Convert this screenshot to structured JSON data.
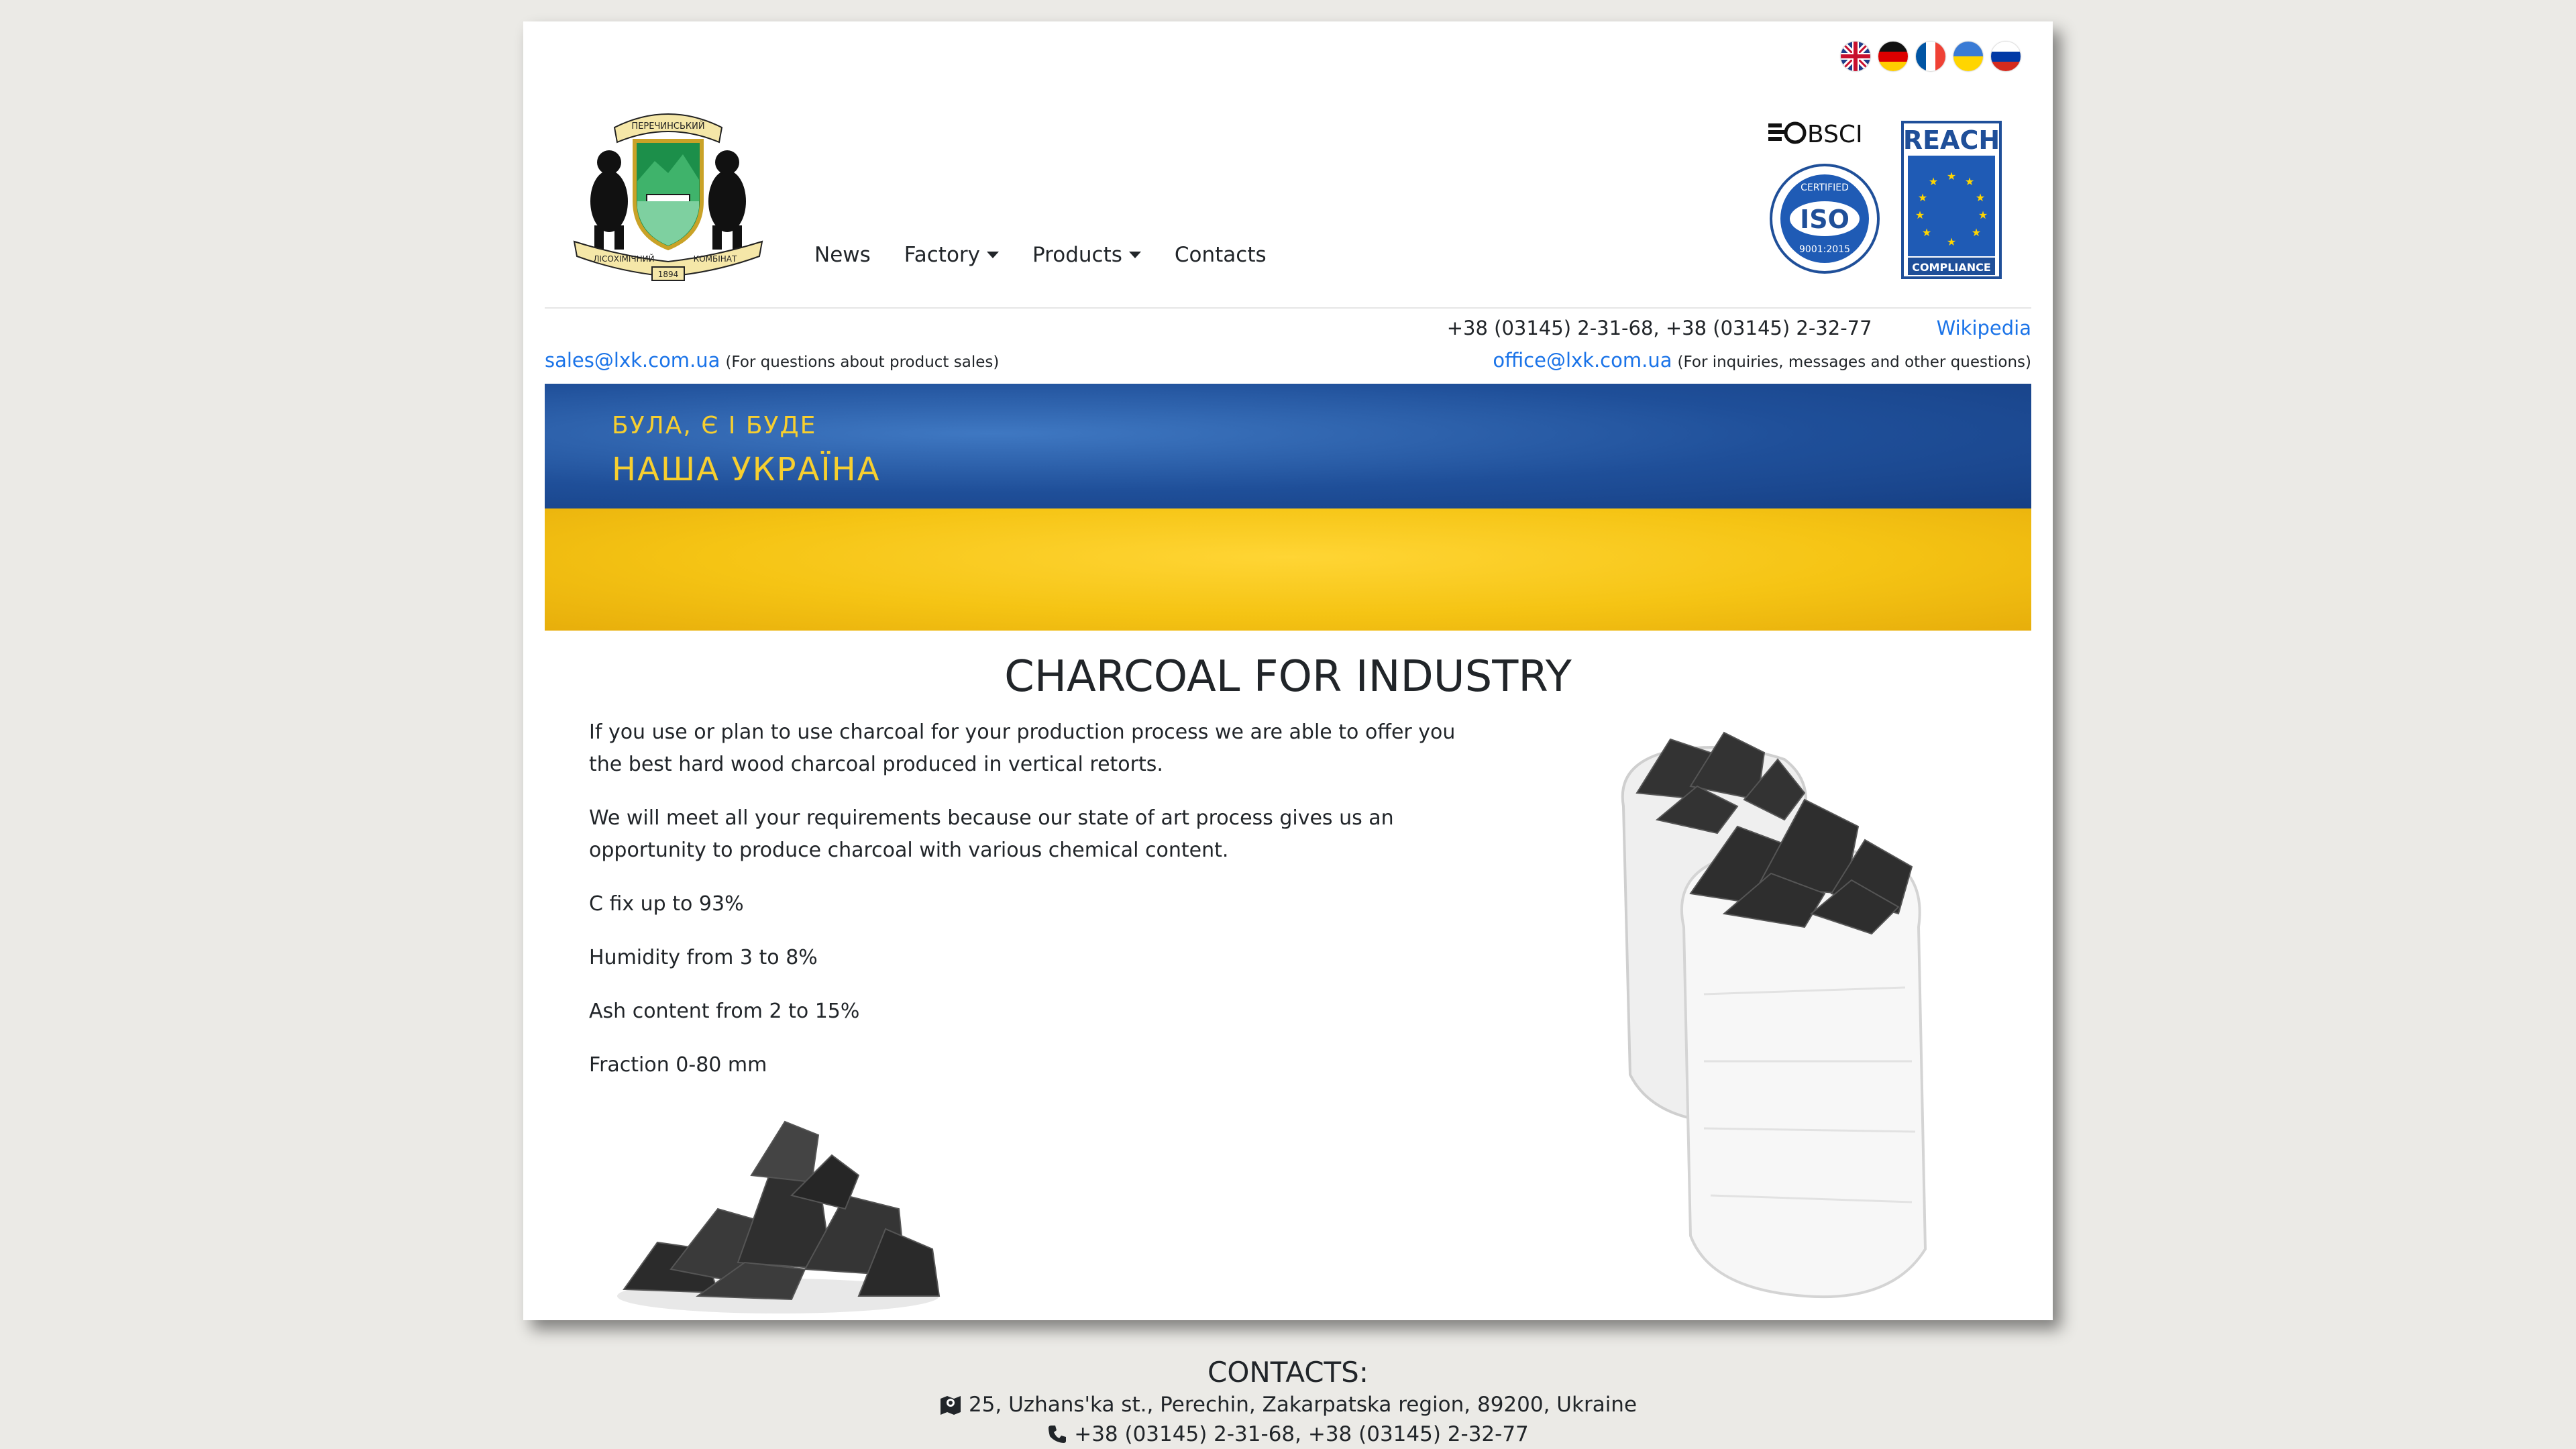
{
  "languages": [
    {
      "code": "en",
      "icon": "uk-flag-icon"
    },
    {
      "code": "de",
      "icon": "germany-flag-icon"
    },
    {
      "code": "fr",
      "icon": "france-flag-icon"
    },
    {
      "code": "ua",
      "icon": "ukraine-flag-icon"
    },
    {
      "code": "ru",
      "icon": "russia-flag-icon"
    }
  ],
  "logo": {
    "top_text": "ПЕРЕЧИНСЬКИЙ",
    "bottom_left": "ЛІСОХІМІЧНИЙ",
    "bottom_right": "КОМБІНАТ",
    "year": "1894"
  },
  "nav": {
    "news": "News",
    "factory": "Factory",
    "products": "Products",
    "contacts": "Contacts"
  },
  "certifications": {
    "bsci": "BSCI",
    "iso_top": "CERTIFIED",
    "iso_mid": "ISO",
    "iso_bottom": "9001:2015",
    "reach_top": "REACH",
    "reach_bottom": "COMPLIANCE"
  },
  "contact_bar": {
    "phones": "+38 (03145) 2-31-68, +38 (03145) 2-32-77",
    "wikipedia": "Wikipedia",
    "sales_email": "sales@lxk.com.ua",
    "sales_note": "(For questions about product sales)",
    "office_email": "office@lxk.com.ua",
    "office_note": "(For inquiries, messages and other questions)"
  },
  "banner": {
    "line1": "БУЛА, Є І БУДЕ",
    "line2": "НАША УКРАЇНА"
  },
  "main": {
    "title": "CHARCOAL FOR INDUSTRY",
    "paragraphs": [
      "If you use or plan to use charcoal for your production process we are able to offer you the best hard wood charcoal produced in vertical retorts.",
      "We will meet all your requirements because our state of art process gives us an opportunity to produce charcoal with various chemical content.",
      "C fix up to 93%",
      "Humidity from 3 to 8%",
      "Ash content from 2 to 15%",
      "Fraction 0-80 mm"
    ]
  },
  "footer": {
    "title": "CONTACTS:",
    "address": "25, Uzhans'ka st., Perechin, Zakarpatska region, 89200, Ukraine",
    "phones": "+38 (03145) 2-31-68, +38 (03145) 2-32-77"
  },
  "colors": {
    "link": "#1a73e8",
    "page_bg": "#ebeae6",
    "ukraine_blue": "#1f4f99",
    "ukraine_yellow": "#f5c414"
  }
}
